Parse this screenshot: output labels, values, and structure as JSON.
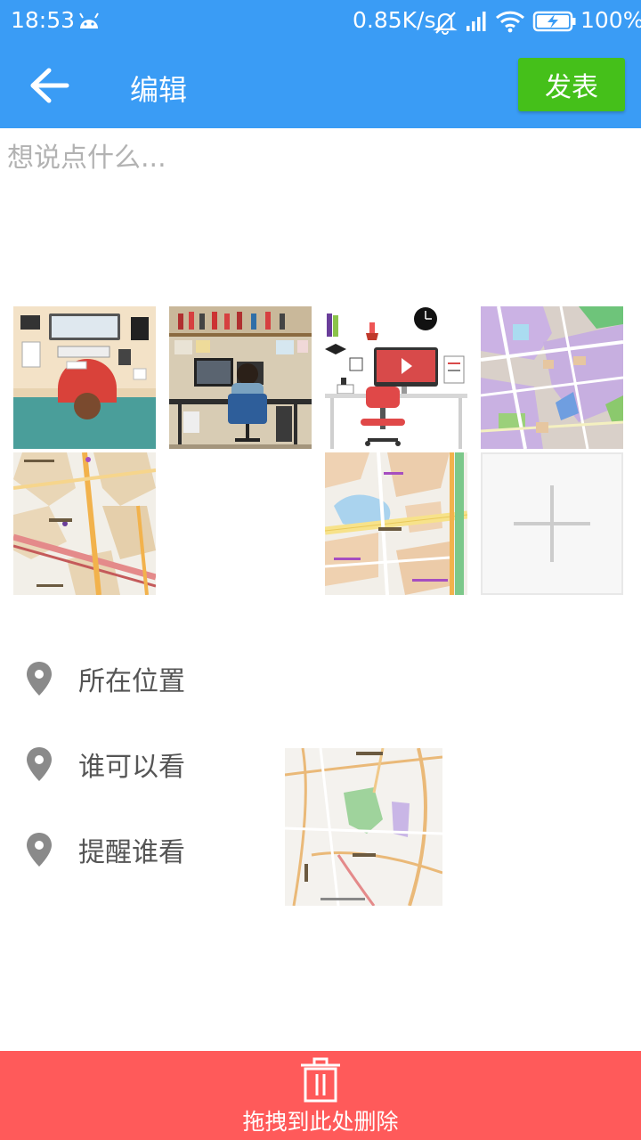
{
  "status_bar": {
    "time": "18:53",
    "network_speed": "0.85K/s",
    "battery_percent": "100%",
    "icons": [
      "android-icon",
      "bell-off-icon",
      "signal-icon",
      "wifi-icon",
      "battery-charging-icon"
    ]
  },
  "header": {
    "back_icon": "arrow-left-icon",
    "title": "编辑",
    "publish_label": "发表",
    "publish_color": "#45c01a",
    "bar_color": "#3a9cf5"
  },
  "compose": {
    "placeholder": "想说点什么...",
    "value": ""
  },
  "photos": {
    "items": [
      "desk-topdown",
      "artist-studio",
      "flat-desk-illustration",
      "city-map-purple",
      "city-map-starbucks",
      "city-map-roads"
    ],
    "add_icon": "plus-icon"
  },
  "options": [
    {
      "icon": "location-pin-icon",
      "label": "所在位置"
    },
    {
      "icon": "location-pin-icon",
      "label": "谁可以看"
    },
    {
      "icon": "location-pin-icon",
      "label": "提醒谁看"
    }
  ],
  "delete_zone": {
    "icon": "trash-icon",
    "label": "拖拽到此处删除",
    "color": "#ff5a5a"
  }
}
